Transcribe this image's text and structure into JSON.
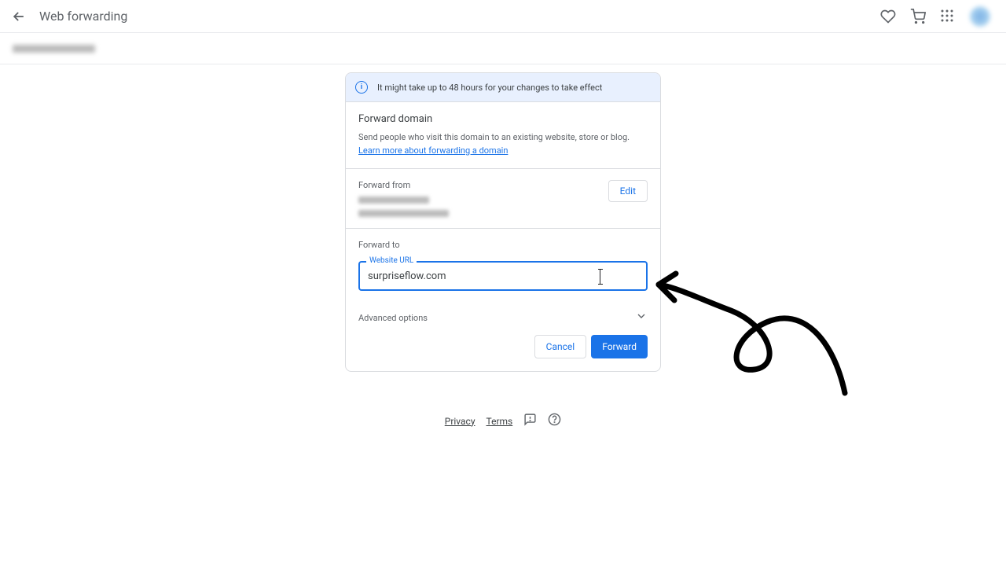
{
  "header": {
    "title": "Web forwarding"
  },
  "banner": {
    "info_text": "It might take up to 48 hours for your changes to take effect"
  },
  "forward_domain": {
    "title": "Forward domain",
    "description": "Send people who visit this domain to an existing website, store or blog. ",
    "learn_more": "Learn more about forwarding a domain"
  },
  "forward_from": {
    "label": "Forward from",
    "edit_label": "Edit"
  },
  "forward_to": {
    "label": "Forward to",
    "input_label": "Website URL",
    "input_value": "surpriseflow.com"
  },
  "advanced": {
    "label": "Advanced options"
  },
  "actions": {
    "cancel": "Cancel",
    "forward": "Forward"
  },
  "footer": {
    "privacy": "Privacy",
    "terms": "Terms"
  }
}
